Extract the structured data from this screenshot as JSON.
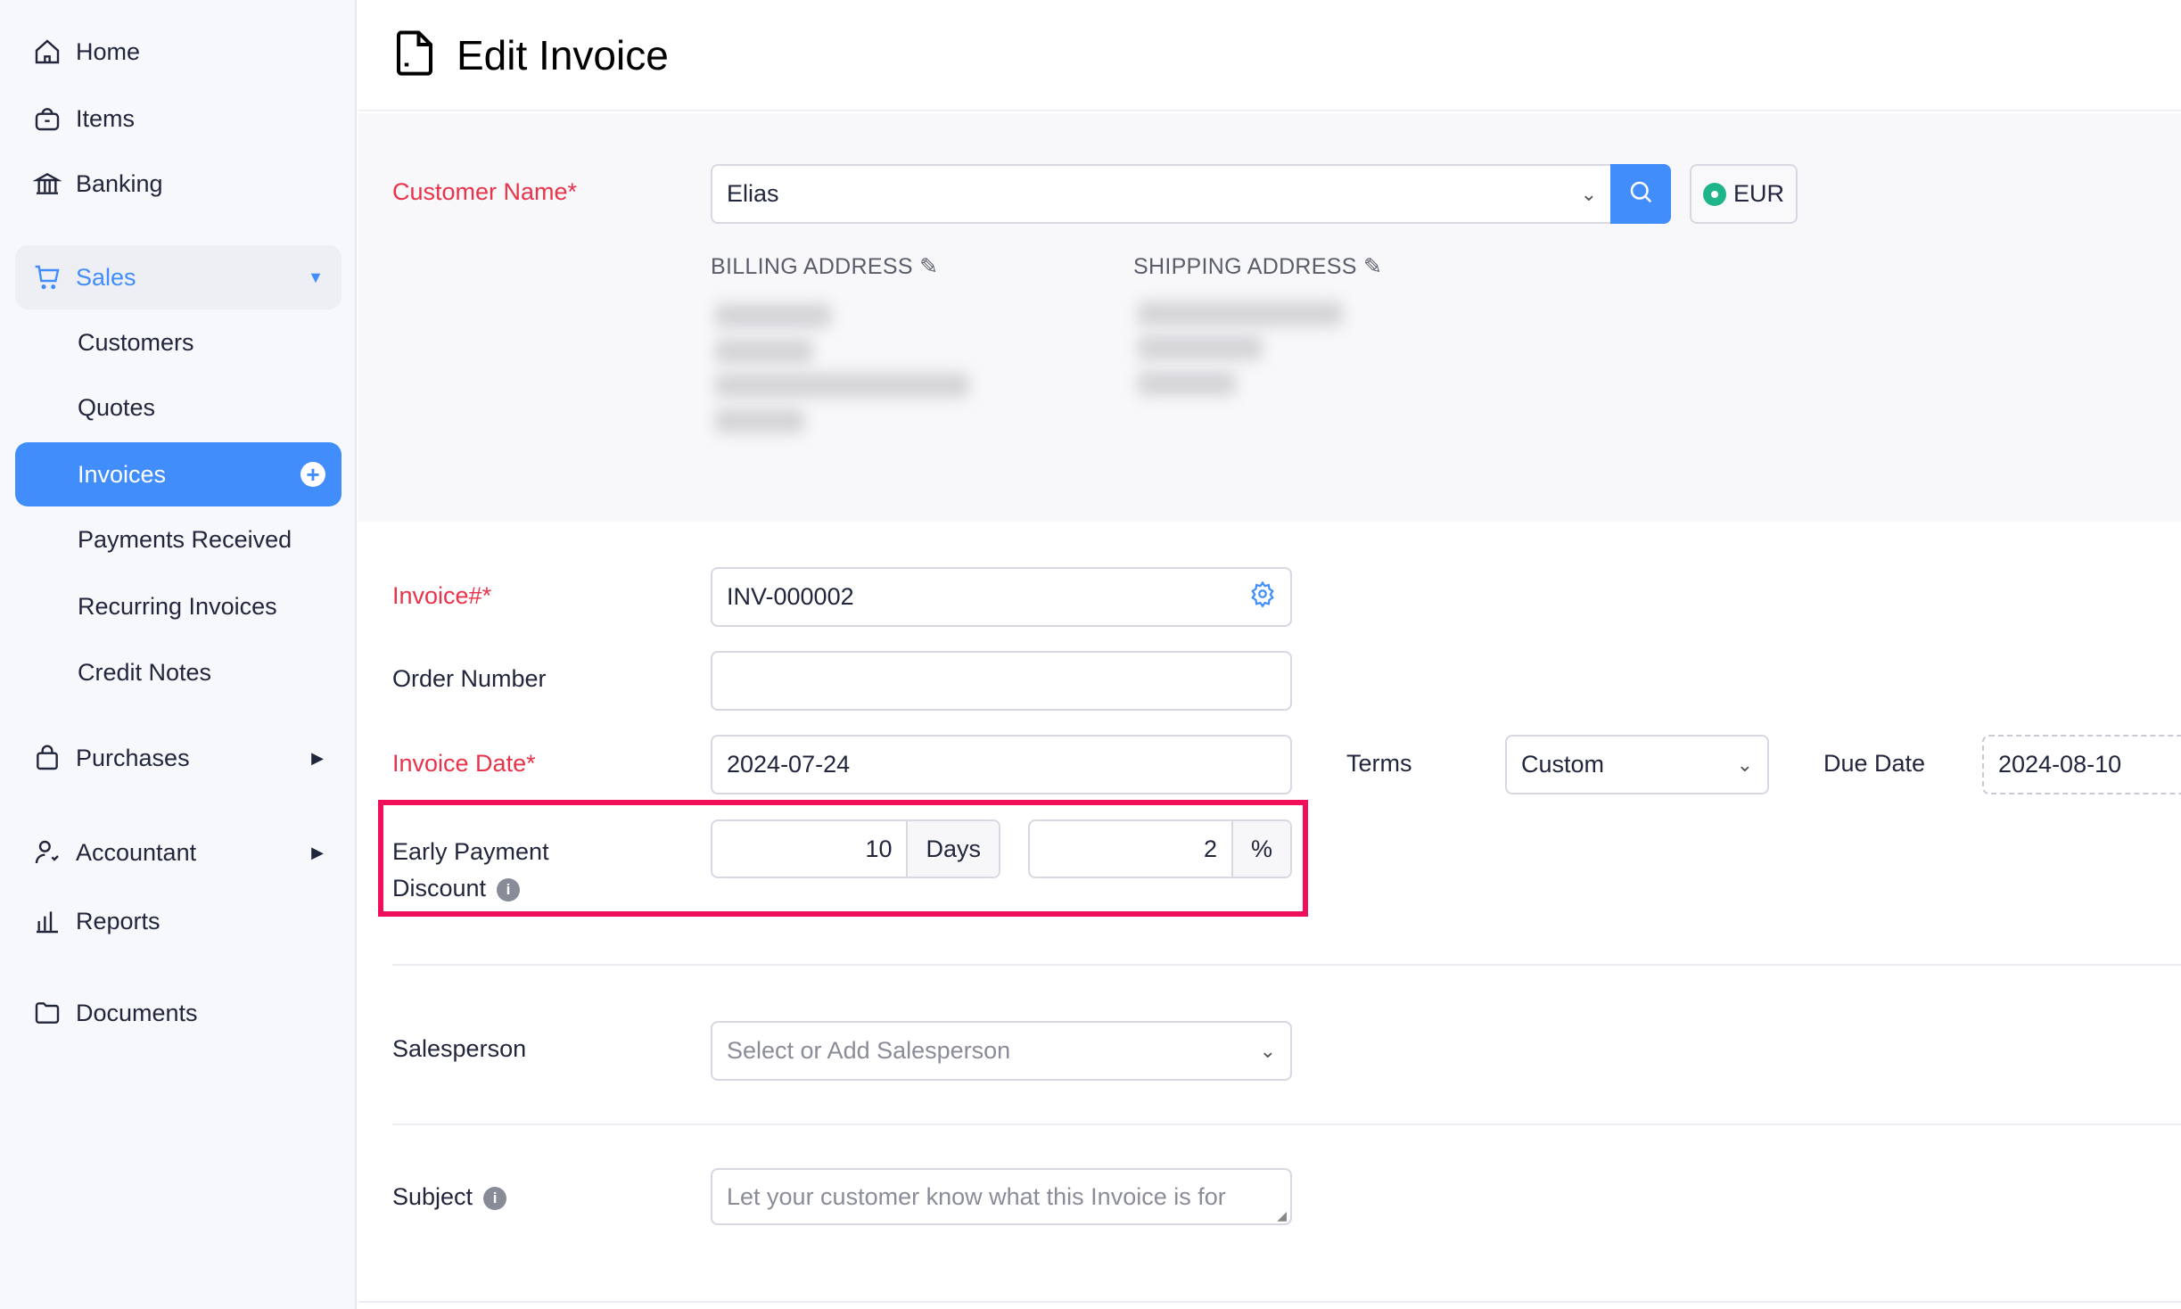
{
  "sidebar": {
    "items": [
      {
        "label": "Home",
        "icon": "home-icon"
      },
      {
        "label": "Items",
        "icon": "bag-icon"
      },
      {
        "label": "Banking",
        "icon": "bank-icon"
      },
      {
        "label": "Sales",
        "icon": "cart-icon"
      },
      {
        "label": "Customers"
      },
      {
        "label": "Quotes"
      },
      {
        "label": "Invoices"
      },
      {
        "label": "Payments Received"
      },
      {
        "label": "Recurring Invoices"
      },
      {
        "label": "Credit Notes"
      },
      {
        "label": "Purchases",
        "icon": "shopping-bag-icon"
      },
      {
        "label": "Accountant",
        "icon": "accountant-icon"
      },
      {
        "label": "Reports",
        "icon": "bar-chart-icon"
      },
      {
        "label": "Documents",
        "icon": "folder-icon"
      }
    ]
  },
  "header": {
    "title": "Edit Invoice"
  },
  "form": {
    "customer_label": "Customer Name*",
    "customer_value": "Elias",
    "currency": "EUR",
    "billing_address": "BILLING ADDRESS",
    "shipping_address": "SHIPPING ADDRESS",
    "invoice_label": "Invoice#*",
    "invoice_value": "INV-000002",
    "order_label": "Order Number",
    "order_value": "",
    "date_label": "Invoice Date*",
    "date_value": "2024-07-24",
    "terms_label": "Terms",
    "terms_value": "Custom",
    "due_label": "Due Date",
    "due_value": "2024-08-10",
    "epd_label_1": "Early Payment",
    "epd_label_2": "Discount",
    "epd_days": "10",
    "epd_days_unit": "Days",
    "epd_percent": "2",
    "epd_percent_unit": "%",
    "salesperson_label": "Salesperson",
    "salesperson_placeholder": "Select or Add Salesperson",
    "subject_label": "Subject",
    "subject_placeholder": "Let your customer know what this Invoice is for"
  },
  "colors": {
    "accent": "#408dfb",
    "required": "#e8334a",
    "highlight": "#f0105a",
    "currency": "#1fb58a"
  }
}
